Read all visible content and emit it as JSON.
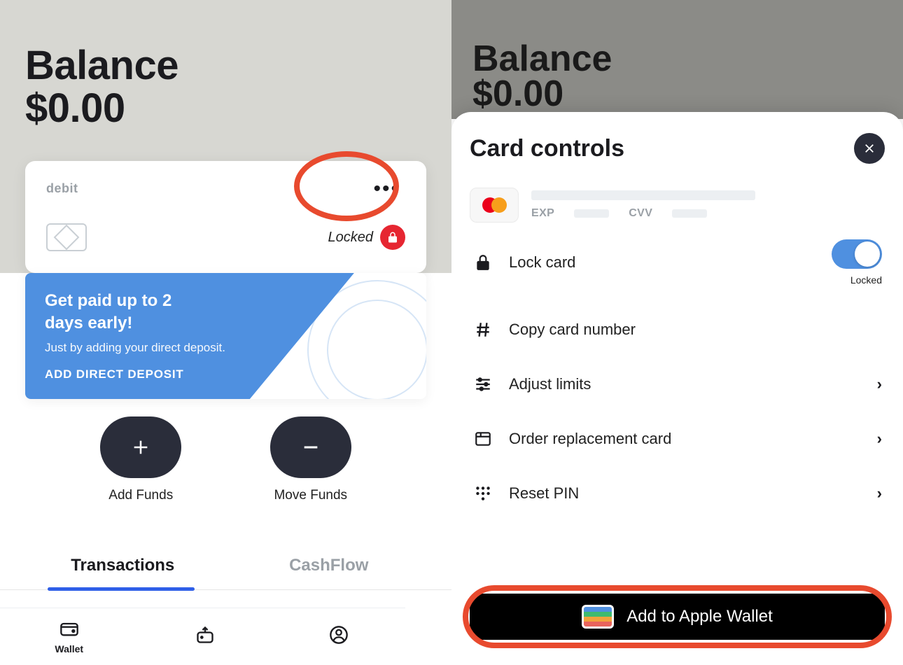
{
  "left": {
    "balance_label": "Balance",
    "balance_amount": "$0.00",
    "card": {
      "type_label": "debit",
      "status_label": "Locked"
    },
    "promo": {
      "title_line1": "Get paid up to 2",
      "title_line2": "days early!",
      "subtitle": "Just by adding your direct deposit.",
      "cta": "ADD DIRECT DEPOSIT"
    },
    "actions": {
      "add_funds": "Add Funds",
      "move_funds": "Move Funds"
    },
    "tabs": {
      "transactions": "Transactions",
      "cashflow": "CashFlow"
    },
    "nav": {
      "wallet": "Wallet"
    }
  },
  "right": {
    "balance_label": "Balance",
    "balance_amount": "$0.00",
    "sheet_title": "Card controls",
    "card_meta": {
      "exp_label": "EXP",
      "cvv_label": "CVV"
    },
    "controls": {
      "lock_card": "Lock card",
      "lock_status": "Locked",
      "copy": "Copy card number",
      "limits": "Adjust limits",
      "replacement": "Order replacement card",
      "reset_pin": "Reset PIN"
    },
    "apple_wallet": "Add to Apple Wallet"
  }
}
